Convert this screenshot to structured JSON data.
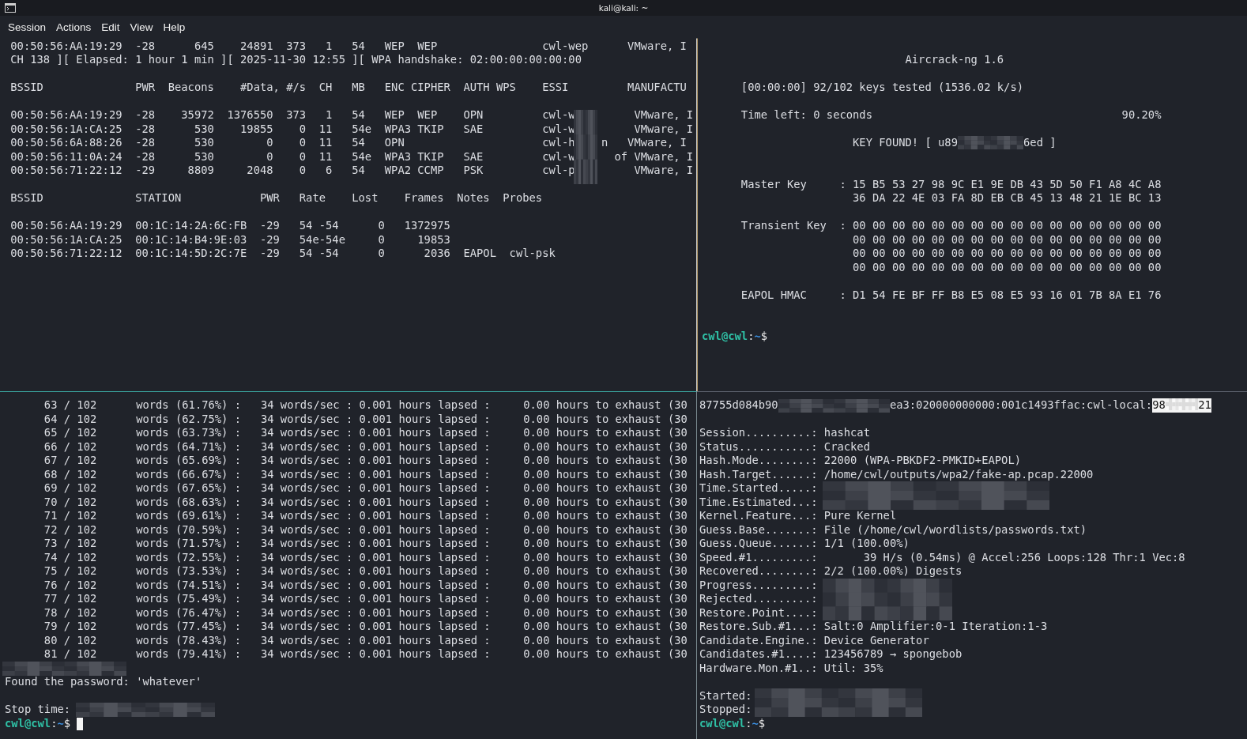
{
  "window": {
    "title": "kali@kali: ~"
  },
  "menu": [
    "Session",
    "Actions",
    "Edit",
    "View",
    "Help"
  ],
  "panes": [
    {
      "active": false,
      "lines": [
        {
          "kind": "text",
          "text": " 00:50:56:AA:19:29  -28      645    24891  373   1   54   WEP  WEP                cwl-wep      VMware, I"
        },
        {
          "kind": "text",
          "text": " CH 138 ][ Elapsed: 1 hour 1 min ][ 2025-11-30 12:55 ][ WPA handshake: 02:00:00:00:00:00"
        },
        {
          "kind": "blank"
        },
        {
          "kind": "text",
          "text": " BSSID              PWR  Beacons    #Data, #/s  CH   MB   ENC CIPHER  AUTH WPS    ESSI         MANUFACTU"
        },
        {
          "kind": "blank"
        },
        {
          "kind": "text",
          "text": " 00:50:56:AA:19:29  -28    35972  1376550  373   1   54   WEP  WEP    OPN         cwl-w         VMware, I"
        },
        {
          "kind": "text",
          "text": " 00:50:56:1A:CA:25  -28      530    19855    0  11   54e  WPA3 TKIP   SAE         cwl-w         VMware, I"
        },
        {
          "kind": "text",
          "text": " 00:50:56:6A:88:26  -28      530        0    0  11   54   OPN                     cwl-h    n   VMware, I"
        },
        {
          "kind": "text",
          "text": " 00:50:56:11:0A:24  -28      530        0    0  11   54e  WPA3 TKIP   SAE         cwl-w      of VMware, I"
        },
        {
          "kind": "text",
          "text": " 00:50:56:71:22:12  -29     8809     2048    0   6   54   WPA2 CCMP   PSK         cwl-p         VMware, I"
        },
        {
          "kind": "blank"
        },
        {
          "kind": "text",
          "text": " BSSID              STATION            PWR   Rate    Lost    Frames  Notes  Probes"
        },
        {
          "kind": "blank"
        },
        {
          "kind": "text",
          "text": " 00:50:56:AA:19:29  00:1C:14:2A:6C:FB  -29   54 -54      0   1372975"
        },
        {
          "kind": "text",
          "text": " 00:50:56:1A:CA:25  00:1C:14:B4:9E:03  -29   54e-54e     0     19853"
        },
        {
          "kind": "text",
          "text": " 00:50:56:71:22:12  00:1C:14:5D:2C:7E  -29   54 -54      0      2036  EAPOL  cwl-psk"
        }
      ],
      "overlays": [
        {
          "kind": "essid"
        }
      ]
    },
    {
      "active": false,
      "lines": [
        {
          "kind": "blank"
        },
        {
          "kind": "text",
          "text": "                               Aircrack-ng 1.6"
        },
        {
          "kind": "blank"
        },
        {
          "kind": "text",
          "text": "      [00:00:00] 92/102 keys tested (1536.02 k/s)"
        },
        {
          "kind": "blank"
        },
        {
          "kind": "text",
          "text": "      Time left: 0 seconds                                      90.20%"
        },
        {
          "kind": "blank"
        },
        {
          "kind": "segments",
          "segments": [
            {
              "kind": "plain",
              "text": "                       KEY FOUND! [ u89"
            },
            {
              "kind": "mask-short"
            },
            {
              "kind": "plain",
              "text": "6ed ]"
            }
          ]
        },
        {
          "kind": "blank"
        },
        {
          "kind": "blank"
        },
        {
          "kind": "text",
          "text": "      Master Key     : 15 B5 53 27 98 9C E1 9E DB 43 5D 50 F1 A8 4C A8"
        },
        {
          "kind": "text",
          "text": "                       36 DA 22 4E 03 FA 8D EB CB 45 13 48 21 1E BC 13"
        },
        {
          "kind": "blank"
        },
        {
          "kind": "text",
          "text": "      Transient Key  : 00 00 00 00 00 00 00 00 00 00 00 00 00 00 00 00"
        },
        {
          "kind": "text",
          "text": "                       00 00 00 00 00 00 00 00 00 00 00 00 00 00 00 00"
        },
        {
          "kind": "text",
          "text": "                       00 00 00 00 00 00 00 00 00 00 00 00 00 00 00 00"
        },
        {
          "kind": "text",
          "text": "                       00 00 00 00 00 00 00 00 00 00 00 00 00 00 00 00"
        },
        {
          "kind": "blank"
        },
        {
          "kind": "text",
          "text": "      EAPOL HMAC     : D1 54 FE BF FF B8 E5 08 E5 93 16 01 7B 8A E1 76"
        },
        {
          "kind": "blank"
        },
        {
          "kind": "blank"
        },
        {
          "kind": "prompt",
          "user": "cwl@cwl",
          "separator": ":",
          "path": "~",
          "symbol": "$",
          "cursor": false
        }
      ]
    },
    {
      "active": true,
      "lines": [
        {
          "kind": "text",
          "text": "      63 / 102      words (61.76%) :   34 words/sec : 0.001 hours lapsed :     0.00 hours to exhaust (30"
        },
        {
          "kind": "text",
          "text": "      64 / 102      words (62.75%) :   34 words/sec : 0.001 hours lapsed :     0.00 hours to exhaust (30"
        },
        {
          "kind": "text",
          "text": "      65 / 102      words (63.73%) :   34 words/sec : 0.001 hours lapsed :     0.00 hours to exhaust (30"
        },
        {
          "kind": "text",
          "text": "      66 / 102      words (64.71%) :   34 words/sec : 0.001 hours lapsed :     0.00 hours to exhaust (30"
        },
        {
          "kind": "text",
          "text": "      67 / 102      words (65.69%) :   34 words/sec : 0.001 hours lapsed :     0.00 hours to exhaust (30"
        },
        {
          "kind": "text",
          "text": "      68 / 102      words (66.67%) :   34 words/sec : 0.001 hours lapsed :     0.00 hours to exhaust (30"
        },
        {
          "kind": "text",
          "text": "      69 / 102      words (67.65%) :   34 words/sec : 0.001 hours lapsed :     0.00 hours to exhaust (30"
        },
        {
          "kind": "text",
          "text": "      70 / 102      words (68.63%) :   34 words/sec : 0.001 hours lapsed :     0.00 hours to exhaust (30"
        },
        {
          "kind": "text",
          "text": "      71 / 102      words (69.61%) :   34 words/sec : 0.001 hours lapsed :     0.00 hours to exhaust (30"
        },
        {
          "kind": "text",
          "text": "      72 / 102      words (70.59%) :   34 words/sec : 0.001 hours lapsed :     0.00 hours to exhaust (30"
        },
        {
          "kind": "text",
          "text": "      73 / 102      words (71.57%) :   34 words/sec : 0.001 hours lapsed :     0.00 hours to exhaust (30"
        },
        {
          "kind": "text",
          "text": "      74 / 102      words (72.55%) :   34 words/sec : 0.001 hours lapsed :     0.00 hours to exhaust (30"
        },
        {
          "kind": "text",
          "text": "      75 / 102      words (73.53%) :   34 words/sec : 0.001 hours lapsed :     0.00 hours to exhaust (30"
        },
        {
          "kind": "text",
          "text": "      76 / 102      words (74.51%) :   34 words/sec : 0.001 hours lapsed :     0.00 hours to exhaust (30"
        },
        {
          "kind": "text",
          "text": "      77 / 102      words (75.49%) :   34 words/sec : 0.001 hours lapsed :     0.00 hours to exhaust (30"
        },
        {
          "kind": "text",
          "text": "      78 / 102      words (76.47%) :   34 words/sec : 0.001 hours lapsed :     0.00 hours to exhaust (30"
        },
        {
          "kind": "text",
          "text": "      79 / 102      words (77.45%) :   34 words/sec : 0.001 hours lapsed :     0.00 hours to exhaust (30"
        },
        {
          "kind": "text",
          "text": "      80 / 102      words (78.43%) :   34 words/sec : 0.001 hours lapsed :     0.00 hours to exhaust (30"
        },
        {
          "kind": "text",
          "text": "      81 / 102      words (79.41%) :   34 words/sec : 0.001 hours lapsed :     0.00 hours to exhaust (30"
        },
        {
          "kind": "blank"
        },
        {
          "kind": "text",
          "text": "Found the password: 'whatever'"
        },
        {
          "kind": "blank"
        },
        {
          "kind": "text",
          "text": "Stop time:"
        },
        {
          "kind": "prompt",
          "user": "cwl@cwl",
          "separator": ":",
          "path": "~",
          "symbol": "$",
          "cursor": true
        }
      ],
      "overlays": [
        {
          "kind": "status"
        },
        {
          "kind": "stop-time"
        }
      ]
    },
    {
      "active": false,
      "lines": [
        {
          "kind": "segments",
          "segments": [
            {
              "kind": "plain",
              "text": "87755d084b90"
            },
            {
              "kind": "mask-long"
            },
            {
              "kind": "plain",
              "text": "ea3:020000000000:001c1493ffac:cwl-local:"
            },
            {
              "kind": "highlight",
              "parts": [
                "98",
                "21"
              ]
            }
          ]
        },
        {
          "kind": "blank"
        },
        {
          "kind": "text",
          "text": "Session..........: hashcat"
        },
        {
          "kind": "text",
          "text": "Status...........: Cracked"
        },
        {
          "kind": "text",
          "text": "Hash.Mode........: 22000 (WPA-PBKDF2-PMKID+EAPOL)"
        },
        {
          "kind": "text",
          "text": "Hash.Target......: /home/cwl/outputs/wpa2/fake-ap.pcap.22000"
        },
        {
          "kind": "text",
          "text": "Time.Started.....:"
        },
        {
          "kind": "text",
          "text": "Time.Estimated...:"
        },
        {
          "kind": "text",
          "text": "Kernel.Feature...: Pure Kernel"
        },
        {
          "kind": "text",
          "text": "Guess.Base.......: File (/home/cwl/wordlists/passwords.txt)"
        },
        {
          "kind": "text",
          "text": "Guess.Queue......: 1/1 (100.00%)"
        },
        {
          "kind": "text",
          "text": "Speed.#1.........:       39 H/s (0.54ms) @ Accel:256 Loops:128 Thr:1 Vec:8"
        },
        {
          "kind": "text",
          "text": "Recovered........: 2/2 (100.00%) Digests"
        },
        {
          "kind": "text",
          "text": "Progress.........:"
        },
        {
          "kind": "text",
          "text": "Rejected.........:"
        },
        {
          "kind": "text",
          "text": "Restore.Point....:"
        },
        {
          "kind": "text",
          "text": "Restore.Sub.#1...: Salt:0 Amplifier:0-1 Iteration:1-3"
        },
        {
          "kind": "text",
          "text": "Candidate.Engine.: Device Generator"
        },
        {
          "kind": "text",
          "text": "Candidates.#1....: 123456789 → spongebob"
        },
        {
          "kind": "text",
          "text": "Hardware.Mon.#1..: Util: 35%"
        },
        {
          "kind": "blank"
        },
        {
          "kind": "text",
          "text": "Started:"
        },
        {
          "kind": "text",
          "text": "Stopped:"
        },
        {
          "kind": "prompt",
          "user": "cwl@cwl",
          "separator": ":",
          "path": "~",
          "symbol": "$",
          "cursor": false
        }
      ],
      "overlays": [
        {
          "kind": "times"
        },
        {
          "kind": "progress"
        },
        {
          "kind": "runtime"
        }
      ]
    }
  ]
}
